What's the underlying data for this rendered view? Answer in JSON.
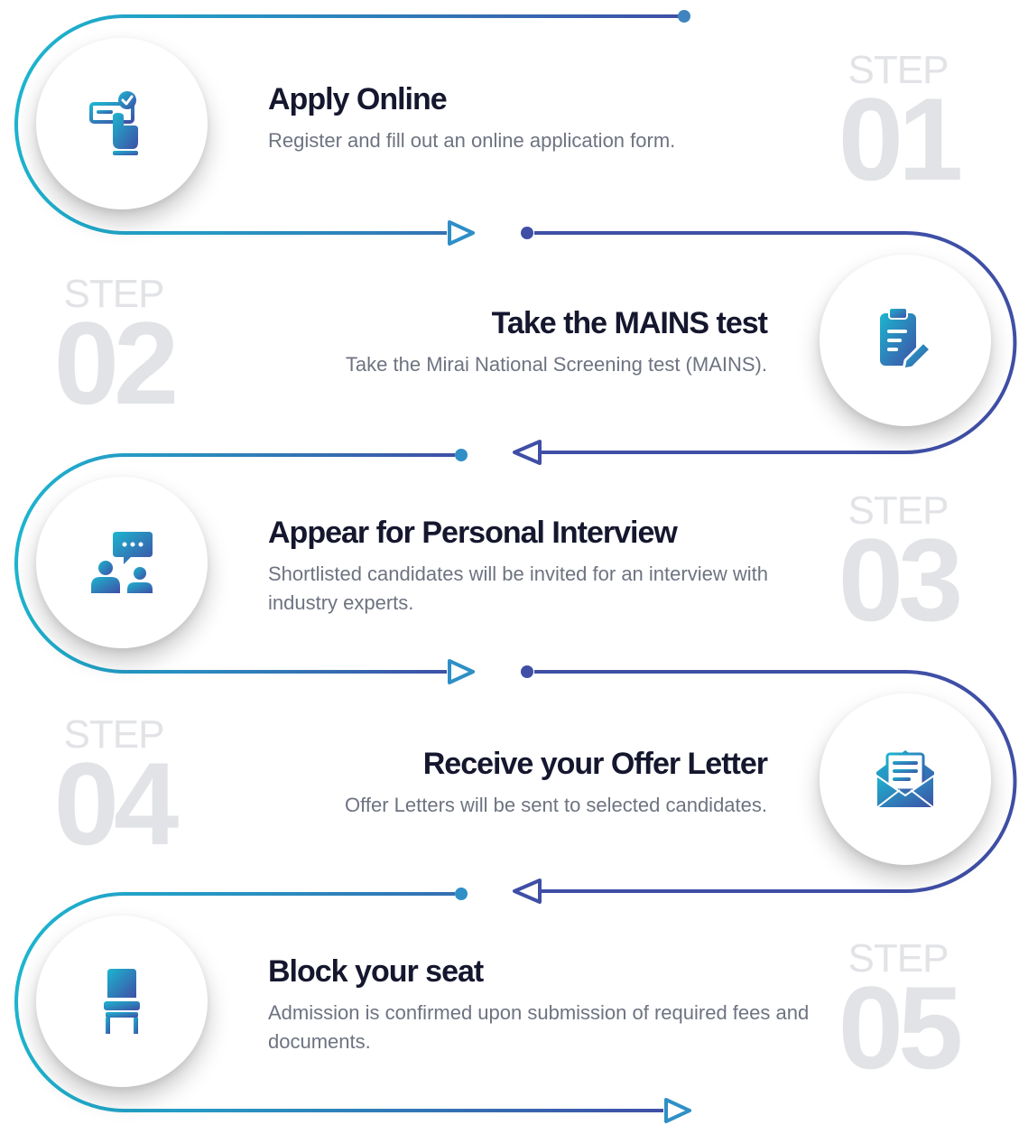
{
  "step_word": "STEP",
  "colors": {
    "teal": "#1cb5cf",
    "navy": "#3f4fa6",
    "label_gray": "#e2e3e6",
    "title": "#15172e",
    "desc": "#6e7381"
  },
  "steps": [
    {
      "number": "01",
      "title": "Apply Online",
      "description": "Register and fill out an online application form.",
      "icon": "apply-online-icon"
    },
    {
      "number": "02",
      "title": "Take the MAINS test",
      "description": "Take the Mirai National Screening test (MAINS).",
      "icon": "clipboard-edit-icon"
    },
    {
      "number": "03",
      "title": "Appear for Personal Interview",
      "description": "Shortlisted candidates will be invited for an interview with industry experts.",
      "icon": "interview-chat-icon"
    },
    {
      "number": "04",
      "title": "Receive your Offer Letter",
      "description": "Offer Letters will be sent to selected candidates.",
      "icon": "envelope-letter-icon"
    },
    {
      "number": "05",
      "title": "Block your seat",
      "description": "Admission is confirmed upon submission of required fees and documents.",
      "icon": "chair-icon"
    }
  ]
}
